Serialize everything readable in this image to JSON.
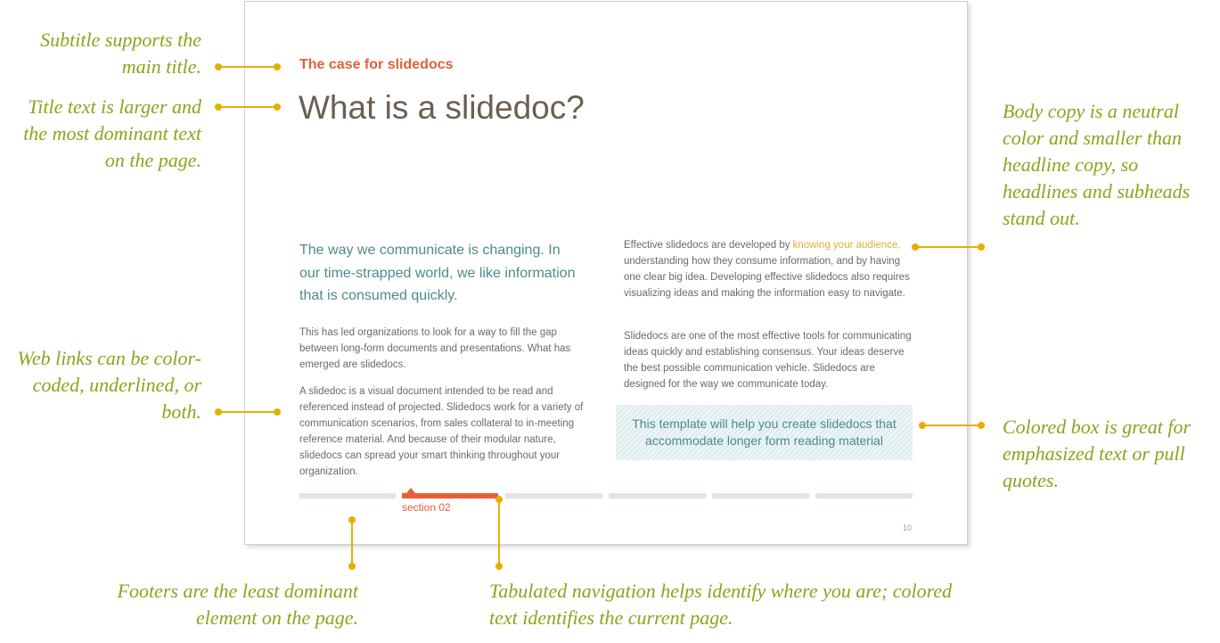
{
  "slide": {
    "subtitle": "The case for slidedocs",
    "title": "What is a slidedoc?",
    "lead": "The way we communicate is changing. In our time-strapped world, we like information that is consumed quickly.",
    "para1": "This has led organizations to look for a way to fill the gap between long-form documents and presentations. What has emerged are slidedocs.",
    "para2": "A slidedoc is a visual document intended to be read and referenced instead of projected. Slidedocs work for a variety of communication scenarios, from sales collateral to in-meeting reference material. And because of their modular nature, slidedocs can spread your smart thinking throughout your organization.",
    "para3_before": "Effective slidedocs are developed by ",
    "para3_link": "knowing your audience,",
    "para3_after": " understanding how they consume information, and by having one clear big idea. Developing effective slidedocs also requires visualizing ideas and making the information easy to navigate.",
    "para4": "Slidedocs are one of the most effective tools for communicating ideas quickly and establishing consensus. Your ideas deserve the best possible communication vehicle. Slidedocs are designed for the way we communicate today.",
    "callout": "This template will help you create slidedocs that accommodate longer form reading material",
    "nav": {
      "tab_count": 6,
      "current_index": 1,
      "current_label": "section 02"
    },
    "page_number": "10"
  },
  "annotations": {
    "subtitle": "Subtitle supports the main title.",
    "title": "Title text is larger and the most dominant text on the page.",
    "links": "Web links can be color-coded, underlined, or both.",
    "body": "Body copy is a neutral color and smaller than headline copy, so headlines and subheads stand out.",
    "box": "Colored box is great for emphasized text or pull quotes.",
    "footer": "Footers are the least dominant element on the page.",
    "nav": "Tabulated navigation helps identify where you are; colored text identifies the current page."
  },
  "colors": {
    "accent": "#e0603a",
    "title": "#6b5f50",
    "lead": "#4f8a8b",
    "link": "#e0b030",
    "annotation": "#8aa51c",
    "callout_dot": "#e6b000"
  }
}
